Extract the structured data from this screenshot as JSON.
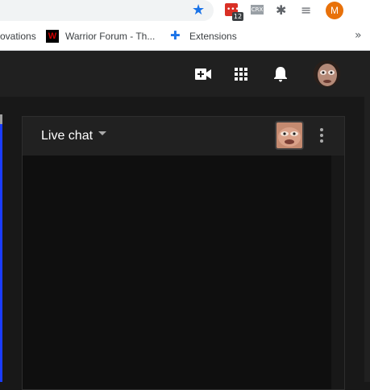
{
  "browser": {
    "extension_badge": "12",
    "crx_label": "CRX",
    "profile_initial": "M"
  },
  "bookmarks": {
    "items": [
      {
        "label": "ovations"
      },
      {
        "label": "Warrior Forum - Th..."
      },
      {
        "label": "Extensions"
      }
    ],
    "overflow": "»"
  },
  "chat": {
    "title": "Live chat"
  },
  "colors": {
    "accent_blue": "#1a73e8",
    "profile_orange": "#e8710a",
    "yt_header": "#202020",
    "chat_bg": "#0f0f0f"
  }
}
